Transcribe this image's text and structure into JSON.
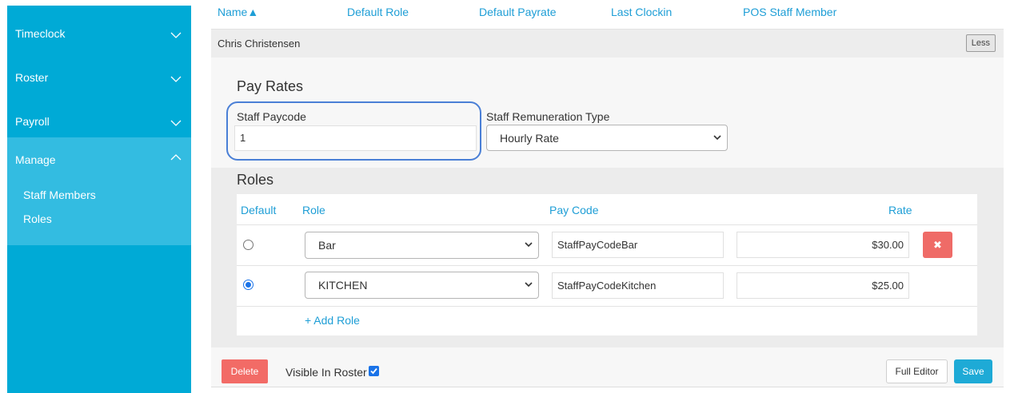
{
  "sidebar": {
    "items": [
      {
        "label": "Timeclock",
        "icon": "chevron-down-icon"
      },
      {
        "label": "Roster",
        "icon": "chevron-down-icon"
      },
      {
        "label": "Payroll",
        "icon": "chevron-down-icon"
      },
      {
        "label": "Manage",
        "icon": "chevron-up-icon"
      }
    ],
    "manage_subitems": [
      "Staff Members",
      "Roles"
    ]
  },
  "table_header": {
    "columns": [
      "Name▲",
      "Default Role",
      "Default Payrate",
      "Last Clockin",
      "POS Staff Member"
    ]
  },
  "staff": {
    "name": "Chris Christensen",
    "less_label": "Less"
  },
  "pay_rates": {
    "title": "Pay Rates",
    "paycode_label": "Staff Paycode",
    "paycode_value": "1",
    "remuneration_label": "Staff Remuneration Type",
    "remuneration_value": "Hourly Rate"
  },
  "roles": {
    "title": "Roles",
    "headers": {
      "default": "Default",
      "role": "Role",
      "pay_code": "Pay Code",
      "rate": "Rate"
    },
    "rows": [
      {
        "default": false,
        "role": "Bar",
        "pay_code": "StaffPayCodeBar",
        "rate": "$30.00",
        "delete_glyph": "✖"
      },
      {
        "default": true,
        "role": "KITCHEN",
        "pay_code": "StaffPayCodeKitchen",
        "rate": "$25.00"
      }
    ],
    "add_role_label": "+ Add Role"
  },
  "footer": {
    "delete_label": "Delete",
    "visible_in_roster_label": "Visible In Roster",
    "visible_in_roster_checked": true,
    "full_editor_label": "Full Editor",
    "save_label": "Save"
  },
  "colors": {
    "sidebar": "#00aad6",
    "sidebar_active": "#33bce1",
    "link": "#1e9ed6",
    "danger": "#f26b66",
    "focus_ring": "#4a7fd6"
  }
}
